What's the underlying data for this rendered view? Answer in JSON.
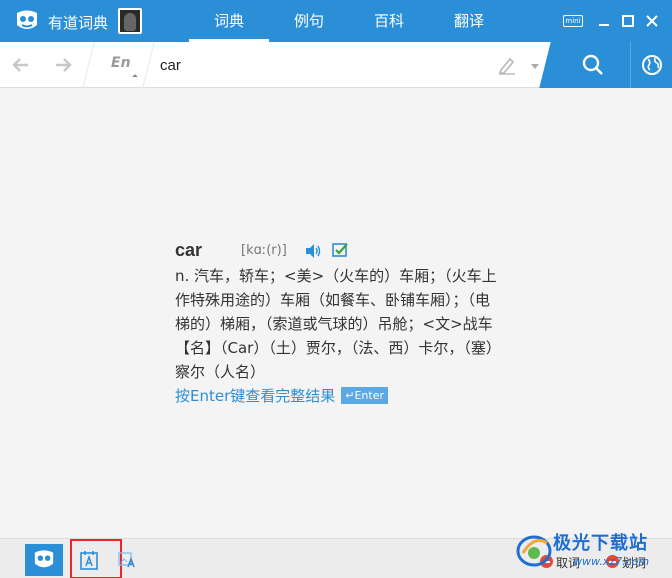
{
  "app": {
    "title": "有道词典"
  },
  "tabs": [
    {
      "label": "词典",
      "active": true
    },
    {
      "label": "例句",
      "active": false
    },
    {
      "label": "百科",
      "active": false
    },
    {
      "label": "翻译",
      "active": false
    }
  ],
  "window_controls": {
    "mini_label": "mini"
  },
  "search": {
    "lang_label": "En",
    "query": "car"
  },
  "result": {
    "headword": "car",
    "phonetic": "[kɑː(r)]",
    "definitions": [
      "n. 汽车，轿车；<美>（火车的）车厢；（火车上作特殊用途的）车厢（如餐车、卧铺车厢）；（电梯的）梯厢，（索道或气球的）吊舱；<文>战车",
      "【名】（Car）（土）贾尔，（法、西）卡尔，（塞）察尔（人名）"
    ],
    "enter_link": "按Enter键查看完整结果",
    "enter_key": "↵Enter"
  },
  "bottom": {
    "toggle_1": "取词",
    "toggle_2": "划词"
  },
  "watermark": {
    "name": "极光下载站",
    "url": "www.xz7.com"
  },
  "colors": {
    "brand_blue": "#2b8fd8",
    "highlight_red": "#e8262b"
  }
}
